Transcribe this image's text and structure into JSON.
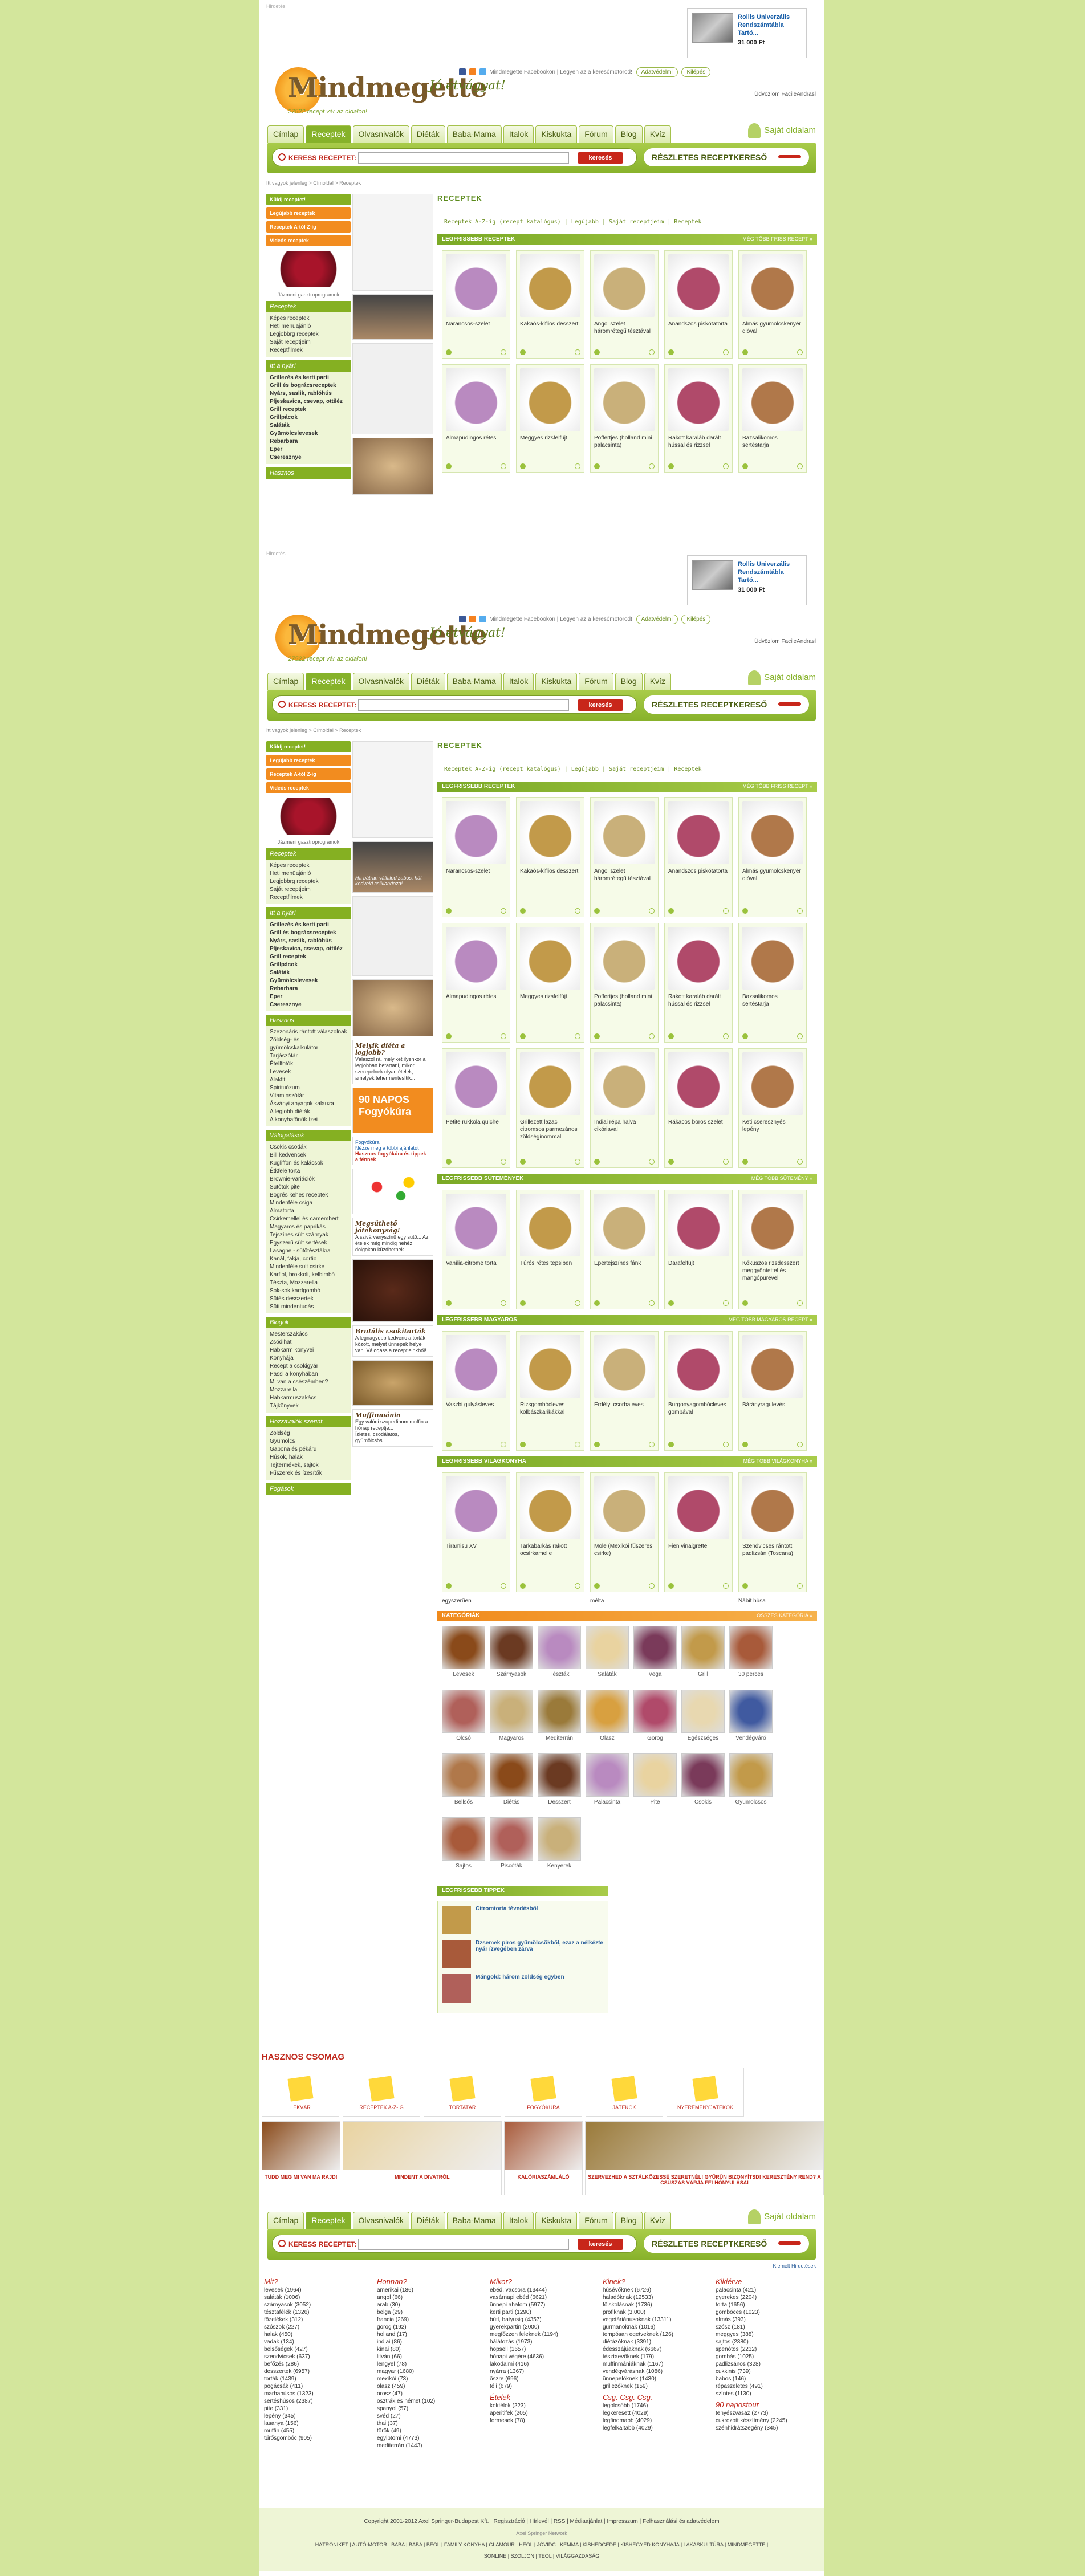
{
  "site": {
    "advert_label": "Hirdetés",
    "ad_title": "Rollis Univerzális Rendszámtábla Tartó...",
    "ad_price": "31 000 Ft",
    "logo": "Mindmegette",
    "slogan": "27522 recept vár az oldalon!",
    "bon": "Jó étvágyat!",
    "social_text": "Mindmegette Facebookon",
    "like_text": "Legyen az a keresőmotorod!",
    "pill1": "Adatvédelmi",
    "pill2": "Kilépés",
    "user": "Üdvözlöm FacileAndrasl",
    "own_page": "Saját oldalam"
  },
  "nav": [
    "Címlap",
    "Receptek",
    "Olvasnivalók",
    "Diéták",
    "Baba-Mama",
    "Italok",
    "Kiskukta",
    "Fórum",
    "Blog",
    "Kvíz"
  ],
  "search": {
    "label": "KERESS RECEPTET:",
    "go": "keresés",
    "advanced": "RÉSZLETES RECEPTKERESŐ"
  },
  "breadcrumb": "Itt vagyok jelenleg > Címoldal > Receptek",
  "left": {
    "buttons": [
      "Küldj receptet!",
      "Legújabb receptek",
      "Receptek A-tól Z-ig",
      "Videós receptek"
    ],
    "photo_caption": "Jázmeni gasztroprogramok",
    "h1": "Receptek",
    "l1": [
      "Képes receptek",
      "Heti menüajánló",
      "Legjobbrg receptek",
      "Saját receptjeim",
      "Receptfilmek"
    ],
    "h2": "Itt a nyár!",
    "l2": [
      "Grillezés és kerti parti",
      "Grill és bográcsreceptek",
      "Nyárs, saslik, rablóhús",
      "Pljeskavica, csevap, ottiléz",
      "Grill receptek",
      "Grillpácok",
      "Saláták",
      "Gyümölcslevesek",
      "Rebarbara",
      "Eper",
      "Cseresznye"
    ],
    "h3": "Hasznos",
    "l3": [
      "Szezonáris rántott válaszolnak",
      "Zöldség- és gyümölcskalkulátor",
      "Tarjászótár",
      "Étellfotók",
      "Levesek",
      "Alakfit",
      "Spirituózum",
      "Vitaminszótár",
      "Ásványi anyagok kalauza",
      "A legjobb diéták",
      "A konyhafőnök ízei"
    ],
    "h4": "Válogatások",
    "l4": [
      "Csokis csodák",
      "Bill kedvencek",
      "Kugliffon és kalácsok",
      "Étkfelé torta",
      "Brownie-variációk",
      "Sütőtök pite",
      "Bögrés kehes receptek",
      "Mindenféle csiga",
      "Almatorta",
      "Csirkemellel és camembert",
      "Magyaros és paprikás",
      "Tejszínes sült szárnyak",
      "Egyszerű sült sertések",
      "Lasagne - sütőtésztákra",
      "Kanál, fakja, cortio",
      "Mindenféle sült csirke",
      "Karfiol, brokkoli, kelbimbó",
      "Tészta, Mozzarella",
      "Sok-sok kardgombó",
      "Sütés desszertek",
      "Süti mindentudás"
    ],
    "h5": "Blogok",
    "l5": [
      "Mesterszakács",
      "Zsódihat",
      "Habkarm könyvei",
      "Konyhája",
      "Recept a csokigyár",
      "Passi a konyhában",
      "Mi van a csészémben?",
      "Mozzarella",
      "Habkarmuszakács",
      "Tájkönyvek"
    ],
    "h6": "Hozzávalók szerint",
    "l6": [
      "Zöldség",
      "Gyümölcs",
      "Gabona és pékáru",
      "Húsok, halak",
      "Tejtermékek, sajtok",
      "Fűszerek és ízesítők"
    ],
    "h7": "Fogások"
  },
  "mid": {
    "promo1": "Ha bátran vállalod zabos, hát kedveld csiklandozd!",
    "p2t": "Melyik diéta a legjobb?",
    "p2": "Válaszol rá, melyiket ilyenkor a legjobban betartani, mikor szerepelnek olyan ételek, amelyek tehermentesítik...",
    "napos": "90 NAPOS Fogyókúra",
    "napos_link": "Fogyókúra",
    "napos_link2": "Nézze meg a többi ajánlatot",
    "napos_q": "Hasznos fogyókúra és tippek a fénnek",
    "p3t": "Megsüthető jótékonyság!",
    "p3": "A szivárványszínű egy sütő... Az ételek még mindig nehéz dolgokon küzdhetnek...",
    "p4t": "Brutális csokitorták",
    "p4": "A legnagyobb kedvenc a torták között, melyet ünnepek helye van. Válogass a receptjeinkből!",
    "p5t": "Muffinmánia",
    "p5": "Egy valódi szuperfinom muffin a hónap receptje...",
    "p5b": "Ízletes, csodálatos, gyümölcsös..."
  },
  "main": {
    "title": "RECEPTEK",
    "note": "Receptek A-Z-ig (recept katalógus) | Legújabb | Saját receptjeim | Receptek",
    "newest": "LEGFRISSEBB RECEPTEK",
    "newest_more": "MÉG TÖBB FRISS RECEPT »",
    "recipes": [
      "Narancsos-szelet",
      "Kakaós-kifliös desszert",
      "Angol szelet háromrétegű tésztával",
      "Anandszos piskótatorta",
      "Almás gyümölcskenyér dióval",
      "Almapudingos rétes",
      "Meggyes rizsfelfújt",
      "Poffertjes (holland mini palacsinta)",
      "Rakott karaláb darált hússal és rizzsel",
      "Bazsalikomos sertéstarja",
      "Petite rukkola quiche",
      "Grillezett lazac citromsos parmezános zöldséginommal",
      "Indiai répa halva cikóriaval",
      "Rákacos boros szelet",
      "Keti cseresznyés lepény"
    ],
    "sweet": "LEGFRISSEBB SÜTEMÉNYEK",
    "sweet_more": "MÉG TÖBB SÜTEMÉNY »",
    "sweets": [
      "Vanília-citrome torta",
      "Túrós rétes tepsiben",
      "Epertejszínes fánk",
      "Darafelfújt",
      "Kókuszos rizsdesszert meggyöntettel és mangópürével"
    ],
    "soup": "LEGFRISSEBB MAGYAROS",
    "soup_more": "MÉG TÖBB MAGYAROS RECEPT »",
    "soups": [
      "Vaszbi gulyásleves",
      "Rizsgombócleves kolbászkarikákkal",
      "Erdélyi csorbaleves",
      "Burgonyagombócleves gombával",
      "Bárányragulevés"
    ],
    "world": "LEGFRISSEBB VILÁGKONYHA",
    "world_more": "MÉG TÖBB VILÁGKONYHA »",
    "worlds": [
      "Tiramisu XV",
      "Tarkabarkás rakott ocsírkamelle",
      "Mole (Mexikói fűszeres csirke)",
      "Fien vinaigrette",
      "Szendvicses rántott padlizsán (Toscana)"
    ],
    "worlds_under": [
      "egyszerűen",
      "",
      "mélta",
      "",
      "Nábit húsa"
    ],
    "cats_title": "KATEGÓRIÁK",
    "cats_more": "ÖSSZES KATEGÓRIA »",
    "cats": [
      "Levesek",
      "Szárnyasok",
      "Tészták",
      "Saláták",
      "Vega",
      "Grill",
      "30 perces",
      "Olcsó",
      "Magyaros",
      "Mediterrán",
      "Olasz",
      "Görög",
      "Egészséges",
      "Vendégváró",
      "Bellsős",
      "Diétás",
      "Desszert",
      "Palacsinta",
      "Pite",
      "Csokis",
      "Gyümölcsös",
      "Sajtos",
      "Piscóták",
      "Kenyerek"
    ],
    "tips_title": "LEGFRISSEBB TIPPEK",
    "tips": [
      "Citromtorta tévedésből",
      "Dzsemek piros gyümölcsökből, ezaz a nélkézte nyár ízvegében zárva",
      "Mángold: három zöldség egyben"
    ]
  },
  "hasznos": {
    "title": "HASZNOS CSOMAG",
    "items": [
      "LEKVÁR",
      "RECEPTEK A-Z-IG",
      "TORTATÁR",
      "FOGYÓKÚRA",
      "JÁTÉKOK",
      "NYEREMÉNYJÁTÉKOK"
    ],
    "banners": [
      "TUDD MEG MI VAN MA RAJD!",
      "MINDENT A DIVATRÓL",
      "KALÓRIASZÁMLÁLÓ",
      "SZERVEZHED A SZTÁLKÖZESSÉ SZERETNÉL! GYŰRŰN BIZONYÍTSD! KERESZTÉNY REND? A CSÚSZÁS VÁRJA FELHŐNYULÁSAI"
    ]
  },
  "directory": [
    {
      "h": "Mit?",
      "items": [
        "levesek (1964)",
        "saláták (1006)",
        "szárnyasok (3052)",
        "tésztafélék (1326)",
        "főzelékek (312)",
        "szószok (227)",
        "halak (450)",
        "vadak (134)",
        "belsőségek (427)",
        "szendvicsek (637)",
        "befőzés (286)",
        "desszertek (6957)",
        "torták (1439)",
        "pogácsák (411)",
        "marhahúsos (1323)",
        "sertéshúsos (2387)",
        "pite (331)",
        "lepény (345)",
        "lasanya (156)",
        "muffin (455)",
        "tűrősgombóc (905)"
      ]
    },
    {
      "h": "Honnan?",
      "items": [
        "amerikai (186)",
        "angol (66)",
        "arab (30)",
        "belga (29)",
        "francia (269)",
        "görög (192)",
        "holland (17)",
        "indiai (86)",
        "kínai (80)",
        "litván (66)",
        "lengyel (78)",
        "magyar (1680)",
        "mexikói (73)",
        "olasz (459)",
        "orosz (47)",
        "osztrák és német (102)",
        "spanyol (57)",
        "svéd (27)",
        "thai (37)",
        "török (49)",
        "egyiptomi (4773)",
        "mediterrán (1443)"
      ]
    },
    {
      "h": "Mikor?",
      "items": [
        "ebéd, vacsora (13444)",
        "vasárnapi ebéd (6621)",
        "ünnepi ahalom (5977)",
        "kerti parti (1290)",
        "bűtl, batyusig (4357)",
        "gyerekpartin (2000)",
        "megfőzzen feleknek (1194)",
        "hálátozás (1973)",
        "hopsell (1657)",
        "hónapi végére (4636)",
        "lakodalmi (416)",
        "nyárra (1367)",
        "őszre (696)",
        "téli (679)"
      ],
      "h2": "Ételek",
      "items2": [
        "koktélok (223)",
        "aperitifek (205)",
        "formesek (78)"
      ]
    },
    {
      "h": "Kinek?",
      "items": [
        "húsévőknek (6726)",
        "haladóknak (12533)",
        "főiskolásnak (1736)",
        "profiknak (3.000)",
        "vegetáriánusoknak (13311)",
        "gurmanoknak (1016)",
        "tempósan egetveknek (126)",
        "diétázóknak (3391)",
        "édesszájúaknak (6667)",
        "tésztaevőknek (179)",
        "muffinmániáknak (1167)",
        "vendégvárásnak (1086)",
        "ünnepelőknek (1430)",
        "grillezőknek (159)"
      ],
      "h2": "Csg. Csg. Csg.",
      "items2": [
        "legolcsóbb (1746)",
        "legkeresett (4029)",
        "legfinomabb (4029)",
        "legfelkaltabb (4029)"
      ]
    },
    {
      "h": "Kikiérve",
      "items": [
        "palacsinta (421)",
        "gyerekes (2204)",
        "torta (1656)",
        "gombóces (1023)",
        "almás (393)",
        "szósz (181)",
        "meggyes (388)",
        "sajtos (2380)",
        "spenótos (2232)",
        "gombás (1025)",
        "padlizsános (328)",
        "cukkinis (739)",
        "babos (146)",
        "répaszeletes (491)",
        "színtes (1130)"
      ],
      "h2": "90 napostour",
      "items2": [
        "tenyészvasaz (2773)",
        "cukrozott készítmény (2245)",
        "szénhidrátszegény (345)"
      ]
    }
  ],
  "footer": {
    "copy": "Copyright 2001-2012 Axel Springer-Budapest Kft. | Regisztráció | Hírlevél | RSS | Médiaajánlat | Impresszum | Felhasználási és adatvédelem",
    "network": "Axel Springer Network",
    "links": "HÁTRONIKET | AUTÓ-MOTOR | BABA | BABA | BEOL | FAMILY KONYHA | GLAMOUR | HEOL | JÓVIDC | KEMMA | KISHÉDGÉDE | KISHÉGYED KONYHÁJA | LAKÁSKULTÚRA | MINDMEGETTE | SONLINE | SZOLJON | TEOL | VILÁGGAZDASÁG",
    "footer_link": "Kiemelt Hirdetések"
  },
  "colors": {
    "green": "#85b022",
    "orange": "#f28c1f",
    "red": "#c0281c",
    "bg": "#d3e69c"
  }
}
